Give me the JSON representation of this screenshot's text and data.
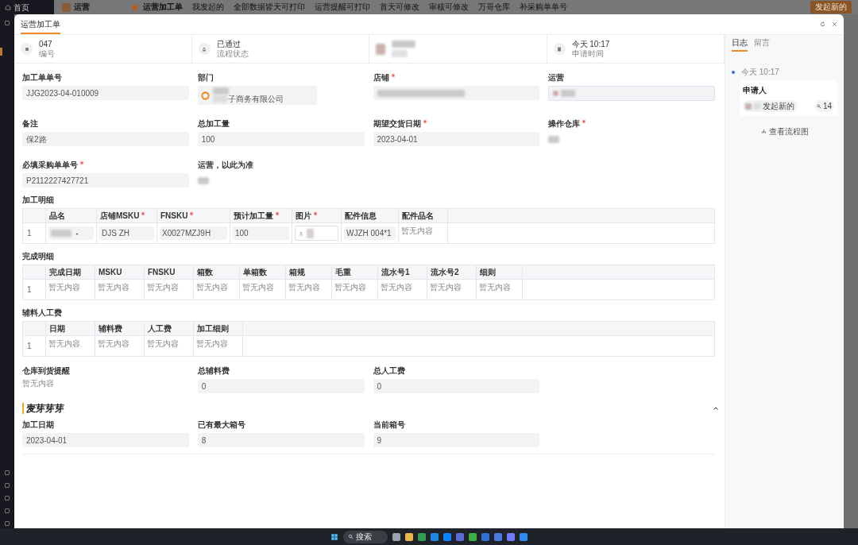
{
  "background_app": {
    "home_label": "首页",
    "module": "运营",
    "tabs": [
      {
        "label": "运营加工单",
        "selected": true
      },
      {
        "label": "我发起的",
        "selected": false
      },
      {
        "label": "全部数据皆天可打印",
        "selected": false
      },
      {
        "label": "运营提醒可打印",
        "selected": false
      },
      {
        "label": "首天可修改",
        "selected": false
      },
      {
        "label": "审核可修改",
        "selected": false
      },
      {
        "label": "万哥仓库",
        "selected": false
      },
      {
        "label": "补采购单单号",
        "selected": false
      }
    ],
    "new_button": "发起新的"
  },
  "window": {
    "tabs": [
      {
        "label": "运营加工单",
        "selected": true
      }
    ]
  },
  "summary": [
    {
      "kind": "number",
      "value": "047",
      "label": "编号"
    },
    {
      "kind": "status",
      "value": "已通过",
      "label": "流程状态"
    },
    {
      "kind": "person"
    },
    {
      "kind": "time",
      "value": "今天 10:17",
      "label": "申请时间"
    }
  ],
  "fields": [
    {
      "label": "加工单单号",
      "required": false,
      "kind": "text",
      "value": "JJG2023-04-010009"
    },
    {
      "label": "部门",
      "required": false,
      "kind": "department",
      "value": "子商务有限公司"
    },
    {
      "label": "店铺",
      "required": true,
      "kind": "redacted"
    },
    {
      "label": "运营",
      "required": false,
      "kind": "person"
    },
    {
      "label": "备注",
      "required": false,
      "kind": "text",
      "value": "保2路"
    },
    {
      "label": "总加工量",
      "required": false,
      "kind": "text",
      "value": "100"
    },
    {
      "label": "期望交货日期",
      "required": true,
      "kind": "text",
      "value": "2023-04-01"
    },
    {
      "label": "操作仓库",
      "required": true,
      "kind": "tag"
    },
    {
      "label": "必填采购单单号",
      "required": true,
      "kind": "text",
      "value": "P2112227427721"
    },
    {
      "label": "运营，以此为准",
      "required": false,
      "kind": "tag"
    }
  ],
  "tables": [
    {
      "title": "加工明细",
      "columns": [
        {
          "label": "品名",
          "required": false
        },
        {
          "label": "店铺MSKU",
          "required": true
        },
        {
          "label": "FNSKU",
          "required": true
        },
        {
          "label": "预计加工量",
          "required": true
        },
        {
          "label": "图片",
          "required": true
        },
        {
          "label": "配件信息",
          "required": false
        },
        {
          "label": "配件品名",
          "required": false
        }
      ],
      "rows": [
        {
          "index": "1",
          "cells": [
            {
              "kind": "redacted"
            },
            {
              "kind": "input",
              "value": "DJS ZH"
            },
            {
              "kind": "input",
              "value": "X0027MZJ9H"
            },
            {
              "kind": "input",
              "value": "100"
            },
            {
              "kind": "upload"
            },
            {
              "kind": "input",
              "value": "WJZH 004*1"
            },
            {
              "kind": "empty",
              "value": "暂无内容"
            }
          ]
        }
      ]
    },
    {
      "title": "完成明细",
      "columns": [
        {
          "label": "完成日期",
          "required": false
        },
        {
          "label": "MSKU",
          "required": false
        },
        {
          "label": "FNSKU",
          "required": false
        },
        {
          "label": "箱数",
          "required": false
        },
        {
          "label": "单箱数",
          "required": false
        },
        {
          "label": "箱规",
          "required": false
        },
        {
          "label": "毛重",
          "required": false
        },
        {
          "label": "流水号1",
          "required": false
        },
        {
          "label": "流水号2",
          "required": false
        },
        {
          "label": "细则",
          "required": false
        }
      ],
      "rows": [
        {
          "index": "1",
          "cells": [
            {
              "kind": "empty",
              "value": "暂无内容"
            },
            {
              "kind": "empty",
              "value": "暂无内容"
            },
            {
              "kind": "empty",
              "value": "暂无内容"
            },
            {
              "kind": "empty",
              "value": "暂无内容"
            },
            {
              "kind": "empty",
              "value": "暂无内容"
            },
            {
              "kind": "empty",
              "value": "暂无内容"
            },
            {
              "kind": "empty",
              "value": "暂无内容"
            },
            {
              "kind": "empty",
              "value": "暂无内容"
            },
            {
              "kind": "empty",
              "value": "暂无内容"
            },
            {
              "kind": "empty",
              "value": "暂无内容"
            }
          ]
        }
      ]
    },
    {
      "title": "辅料人工费",
      "columns": [
        {
          "label": "日期",
          "required": false
        },
        {
          "label": "辅料费",
          "required": false
        },
        {
          "label": "人工费",
          "required": false
        },
        {
          "label": "加工细则",
          "required": false
        }
      ],
      "rows": [
        {
          "index": "1",
          "cells": [
            {
              "kind": "empty",
              "value": "暂无内容"
            },
            {
              "kind": "empty",
              "value": "暂无内容"
            },
            {
              "kind": "empty",
              "value": "暂无内容"
            },
            {
              "kind": "empty",
              "value": "暂无内容"
            }
          ]
        }
      ]
    }
  ],
  "totals": [
    {
      "label": "仓库到货提醒",
      "kind": "empty",
      "value": "暂无内容"
    },
    {
      "label": "总辅料费",
      "kind": "text",
      "value": "0"
    },
    {
      "label": "总人工费",
      "kind": "text",
      "value": "0"
    }
  ],
  "section": {
    "title": "麦芽芽芽",
    "expanded": true,
    "fields": [
      {
        "label": "加工日期",
        "value": "2023-04-01"
      },
      {
        "label": "已有最大箱号",
        "value": "8"
      },
      {
        "label": "当前箱号",
        "value": "9"
      }
    ]
  },
  "side_panel": {
    "tabs": [
      {
        "label": "日志",
        "selected": true
      },
      {
        "label": "留言",
        "selected": false
      }
    ],
    "log": [
      {
        "time": "今天 10:17",
        "role": "申请人",
        "action": "发起新的",
        "count": "14"
      }
    ],
    "flow_link": "查看流程图"
  },
  "taskbar": {
    "search": "搜索"
  }
}
